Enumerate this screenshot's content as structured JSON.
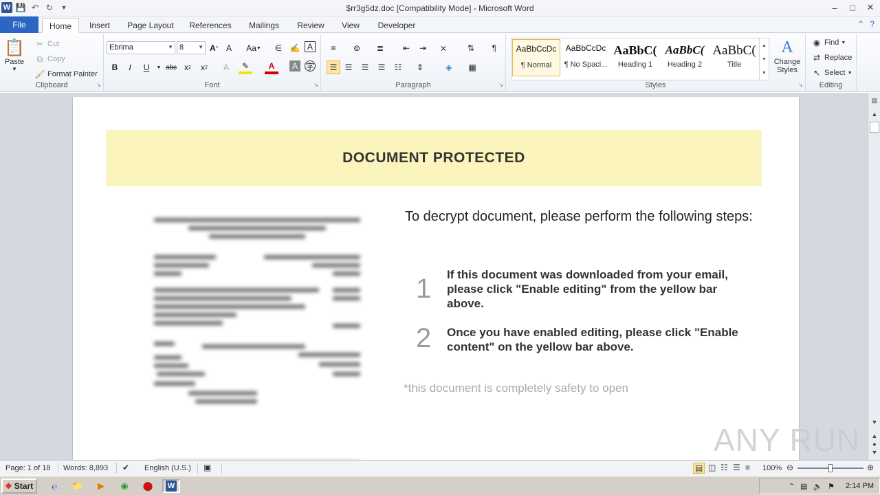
{
  "window": {
    "title": "$rr3g5dz.doc [Compatibility Mode] - Microsoft Word"
  },
  "tabs": [
    "File",
    "Home",
    "Insert",
    "Page Layout",
    "References",
    "Mailings",
    "Review",
    "View",
    "Developer"
  ],
  "active_tab": "Home",
  "clipboard": {
    "paste": "Paste",
    "cut": "Cut",
    "copy": "Copy",
    "format_painter": "Format Painter",
    "group_label": "Clipboard"
  },
  "font": {
    "name": "Ebrima",
    "size": "8",
    "group_label": "Font"
  },
  "paragraph": {
    "group_label": "Paragraph"
  },
  "styles": {
    "items": [
      {
        "sample": "AaBbCcDc",
        "name": "¶ Normal"
      },
      {
        "sample": "AaBbCcDc",
        "name": "¶ No Spaci..."
      },
      {
        "sample": "AaBbC(",
        "name": "Heading 1"
      },
      {
        "sample": "AaBbC(",
        "name": "Heading 2"
      },
      {
        "sample": "AaBbC(",
        "name": "Title"
      }
    ],
    "change_styles": "Change Styles",
    "group_label": "Styles"
  },
  "editing": {
    "find": "Find",
    "replace": "Replace",
    "select": "Select",
    "group_label": "Editing"
  },
  "document": {
    "banner": "DOCUMENT PROTECTED",
    "heading": "To decrypt document, please perform the following steps:",
    "steps": [
      {
        "num": "1",
        "text": "If this document was downloaded from your email, please click \"Enable editing\" from the yellow bar above."
      },
      {
        "num": "2",
        "text": "Once you have enabled editing, please click \"Enable content\" on the yellow bar above."
      }
    ],
    "footnote": "*this document is completely safety to open"
  },
  "watermark": "ANY RUN",
  "status": {
    "page": "Page: 1 of 18",
    "words": "Words: 8,893",
    "language": "English (U.S.)",
    "zoom": "100%",
    "zoom_level": 1.0
  },
  "taskbar": {
    "start": "Start",
    "clock": "2:14 PM"
  }
}
